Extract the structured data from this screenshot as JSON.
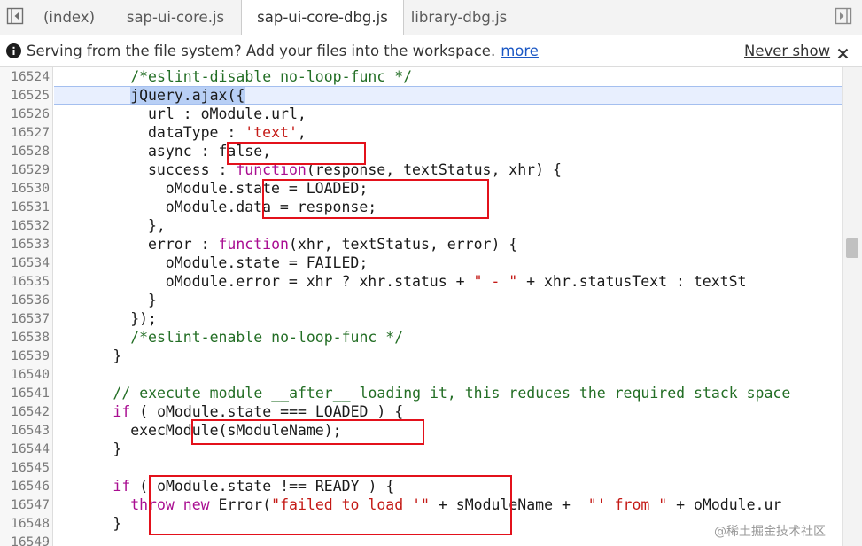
{
  "tabbar": {
    "tabs": [
      {
        "label": "(index)",
        "active": false
      },
      {
        "label": "sap-ui-core.js",
        "active": false
      },
      {
        "label": "sap-ui-core-dbg.js",
        "active": true
      },
      {
        "label": "library-dbg.js",
        "active": false
      }
    ],
    "left_icon": "toggle-navigator-icon",
    "right_icon": "toggle-debugger-icon"
  },
  "infobar": {
    "icon": "info-icon",
    "message": "Serving from the file system? Add your files into the workspace.",
    "more_link": "more",
    "never_show": "Never show",
    "close_icon": "close-icon"
  },
  "editor": {
    "current_line": "16525",
    "lines": [
      {
        "n": "16524",
        "indent": 8,
        "tokens": [
          {
            "t": "/*eslint-disable no-loop-func */",
            "c": "comment"
          }
        ]
      },
      {
        "n": "16525",
        "indent": 8,
        "tokens": [
          {
            "t": "jQuery.ajax({",
            "c": "select"
          }
        ]
      },
      {
        "n": "16526",
        "indent": 10,
        "tokens": [
          {
            "t": "url : oModule.url,",
            "c": ""
          }
        ]
      },
      {
        "n": "16527",
        "indent": 10,
        "tokens": [
          {
            "t": "dataType : ",
            "c": ""
          },
          {
            "t": "'text'",
            "c": "string"
          },
          {
            "t": ",",
            "c": ""
          }
        ]
      },
      {
        "n": "16528",
        "indent": 10,
        "tokens": [
          {
            "t": "async : false,",
            "c": ""
          }
        ]
      },
      {
        "n": "16529",
        "indent": 10,
        "tokens": [
          {
            "t": "success : ",
            "c": ""
          },
          {
            "t": "function",
            "c": "keyword"
          },
          {
            "t": "(response, textStatus, xhr) {",
            "c": ""
          }
        ]
      },
      {
        "n": "16530",
        "indent": 12,
        "tokens": [
          {
            "t": "oModule.state = LOADED;",
            "c": ""
          }
        ]
      },
      {
        "n": "16531",
        "indent": 12,
        "tokens": [
          {
            "t": "oModule.data = response;",
            "c": ""
          }
        ]
      },
      {
        "n": "16532",
        "indent": 10,
        "tokens": [
          {
            "t": "},",
            "c": ""
          }
        ]
      },
      {
        "n": "16533",
        "indent": 10,
        "tokens": [
          {
            "t": "error : ",
            "c": ""
          },
          {
            "t": "function",
            "c": "keyword"
          },
          {
            "t": "(xhr, textStatus, error) {",
            "c": ""
          }
        ]
      },
      {
        "n": "16534",
        "indent": 12,
        "tokens": [
          {
            "t": "oModule.state = FAILED;",
            "c": ""
          }
        ]
      },
      {
        "n": "16535",
        "indent": 12,
        "tokens": [
          {
            "t": "oModule.error = xhr ? xhr.status + ",
            "c": ""
          },
          {
            "t": "\" - \"",
            "c": "string"
          },
          {
            "t": " + xhr.statusText : textSt",
            "c": ""
          }
        ]
      },
      {
        "n": "16536",
        "indent": 10,
        "tokens": [
          {
            "t": "}",
            "c": ""
          }
        ]
      },
      {
        "n": "16537",
        "indent": 8,
        "tokens": [
          {
            "t": "});",
            "c": ""
          }
        ]
      },
      {
        "n": "16538",
        "indent": 8,
        "tokens": [
          {
            "t": "/*eslint-enable no-loop-func */",
            "c": "comment"
          }
        ]
      },
      {
        "n": "16539",
        "indent": 6,
        "tokens": [
          {
            "t": "}",
            "c": ""
          }
        ]
      },
      {
        "n": "16540",
        "indent": 0,
        "tokens": []
      },
      {
        "n": "16541",
        "indent": 6,
        "tokens": [
          {
            "t": "// execute module __after__ loading it, this reduces the required stack space",
            "c": "comment"
          }
        ]
      },
      {
        "n": "16542",
        "indent": 6,
        "tokens": [
          {
            "t": "if",
            "c": "keyword"
          },
          {
            "t": " ( oModule.state === LOADED ) {",
            "c": ""
          }
        ]
      },
      {
        "n": "16543",
        "indent": 8,
        "tokens": [
          {
            "t": "execModule(sModuleName);",
            "c": ""
          }
        ]
      },
      {
        "n": "16544",
        "indent": 6,
        "tokens": [
          {
            "t": "}",
            "c": ""
          }
        ]
      },
      {
        "n": "16545",
        "indent": 0,
        "tokens": []
      },
      {
        "n": "16546",
        "indent": 6,
        "tokens": [
          {
            "t": "if",
            "c": "keyword"
          },
          {
            "t": " ( oModule.state !== READY ) {",
            "c": ""
          }
        ]
      },
      {
        "n": "16547",
        "indent": 8,
        "tokens": [
          {
            "t": "throw",
            "c": "keyword"
          },
          {
            "t": " ",
            "c": ""
          },
          {
            "t": "new",
            "c": "keyword"
          },
          {
            "t": " Error(",
            "c": ""
          },
          {
            "t": "\"failed to load '\"",
            "c": "string"
          },
          {
            "t": " + sModuleName +  ",
            "c": ""
          },
          {
            "t": "\"' from \"",
            "c": "string"
          },
          {
            "t": " + oModule.ur",
            "c": ""
          }
        ]
      },
      {
        "n": "16548",
        "indent": 6,
        "tokens": [
          {
            "t": "}",
            "c": ""
          }
        ]
      },
      {
        "n": "16549",
        "indent": 0,
        "tokens": []
      }
    ]
  },
  "watermark": "@稀土掘金技术社区"
}
